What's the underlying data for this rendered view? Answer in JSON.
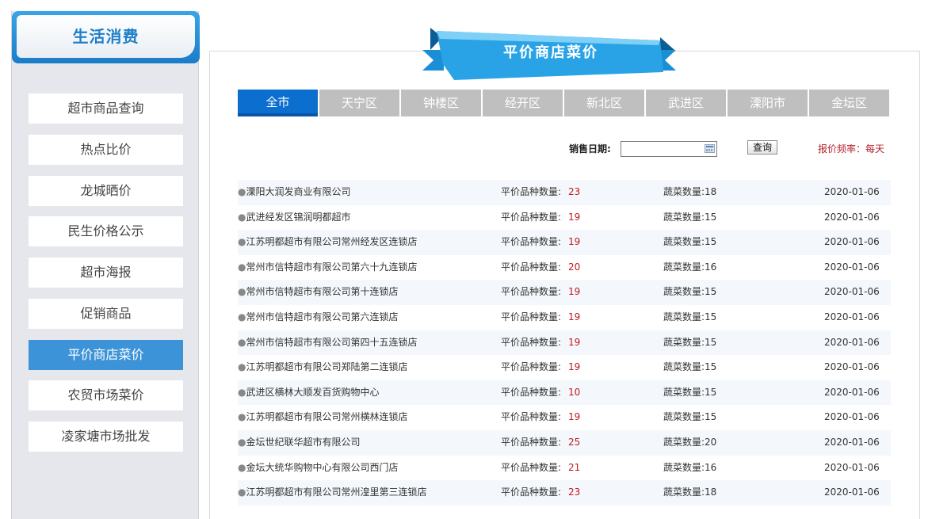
{
  "sidebar": {
    "title": "生活消费",
    "items": [
      {
        "label": "超市商品查询"
      },
      {
        "label": "热点比价"
      },
      {
        "label": "龙城晒价"
      },
      {
        "label": "民生价格公示"
      },
      {
        "label": "超市海报"
      },
      {
        "label": "促销商品"
      },
      {
        "label": "平价商店菜价"
      },
      {
        "label": "农贸市场菜价"
      },
      {
        "label": "凌家塘市场批发"
      }
    ],
    "active_index": 6
  },
  "main": {
    "title": "平价商店菜价",
    "tabs": [
      {
        "label": "全市"
      },
      {
        "label": "天宁区"
      },
      {
        "label": "钟楼区"
      },
      {
        "label": "经开区"
      },
      {
        "label": "新北区"
      },
      {
        "label": "武进区"
      },
      {
        "label": "溧阳市"
      },
      {
        "label": "金坛区"
      }
    ],
    "active_tab": 0,
    "date_label": "销售日期:",
    "date_value": "",
    "query_label": "查询",
    "frequency": "报价频率：每天",
    "count_label": "平价品种数量:",
    "veg_label": "蔬菜数量:",
    "stores": [
      {
        "name": "溧阳大润发商业有限公司",
        "count": "23",
        "veg": "18",
        "date": "2020-01-06"
      },
      {
        "name": "武进经发区锦润明都超市",
        "count": "19",
        "veg": "15",
        "date": "2020-01-06"
      },
      {
        "name": "江苏明都超市有限公司常州经发区连锁店",
        "count": "19",
        "veg": "15",
        "date": "2020-01-06"
      },
      {
        "name": "常州市信特超市有限公司第六十九连锁店",
        "count": "20",
        "veg": "16",
        "date": "2020-01-06"
      },
      {
        "name": "常州市信特超市有限公司第十连锁店",
        "count": "19",
        "veg": "15",
        "date": "2020-01-06"
      },
      {
        "name": "常州市信特超市有限公司第六连锁店",
        "count": "19",
        "veg": "15",
        "date": "2020-01-06"
      },
      {
        "name": "常州市信特超市有限公司第四十五连锁店",
        "count": "19",
        "veg": "15",
        "date": "2020-01-06"
      },
      {
        "name": "江苏明都超市有限公司郑陆第二连锁店",
        "count": "19",
        "veg": "15",
        "date": "2020-01-06"
      },
      {
        "name": "武进区横林大顺发百货购物中心",
        "count": "10",
        "veg": "15",
        "date": "2020-01-06"
      },
      {
        "name": "江苏明都超市有限公司常州横林连锁店",
        "count": "19",
        "veg": "15",
        "date": "2020-01-06"
      },
      {
        "name": "金坛世纪联华超市有限公司",
        "count": "25",
        "veg": "20",
        "date": "2020-01-06"
      },
      {
        "name": "金坛大统华购物中心有限公司西门店",
        "count": "21",
        "veg": "16",
        "date": "2020-01-06"
      },
      {
        "name": "江苏明都超市有限公司常州湟里第三连锁店",
        "count": "23",
        "veg": "18",
        "date": "2020-01-06"
      }
    ]
  }
}
